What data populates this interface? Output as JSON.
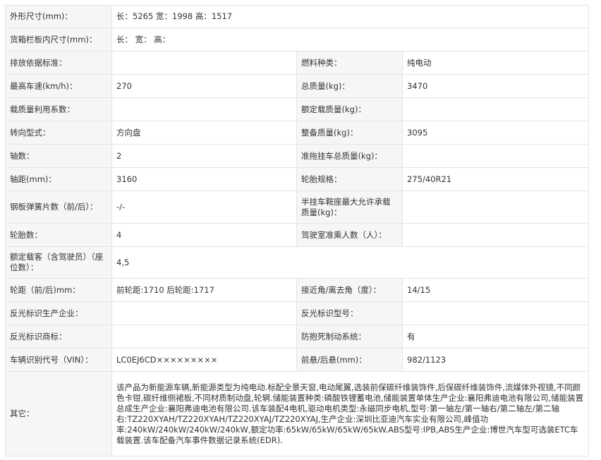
{
  "rows": [
    {
      "type": "wide",
      "label": "外形尺寸(mm)：",
      "value": "长：5265 宽：1998 高：1517"
    },
    {
      "type": "wide",
      "label": "货箱栏板内尺寸(mm)：",
      "value": "长：  宽：  高："
    },
    {
      "type": "pair",
      "label1": "排放依据标准：",
      "value1": "",
      "label2": "燃料种类：",
      "value2": "纯电动"
    },
    {
      "type": "pair",
      "label1": "最高车速(km/h)：",
      "value1": "270",
      "label2": "总质量(kg)：",
      "value2": "3470"
    },
    {
      "type": "pair",
      "label1": "载质量利用系数：",
      "value1": "",
      "label2": "额定载质量(kg)：",
      "value2": ""
    },
    {
      "type": "pair",
      "label1": "转向型式：",
      "value1": "方向盘",
      "label2": "整备质量(kg)：",
      "value2": "3095"
    },
    {
      "type": "pair",
      "label1": "轴数：",
      "value1": "2",
      "label2": "准拖挂车总质量(kg)：",
      "value2": ""
    },
    {
      "type": "pair",
      "label1": "轴距(mm)：",
      "value1": "3160",
      "label2": "轮胎规格：",
      "value2": "275/40R21"
    },
    {
      "type": "pair",
      "label1": "钢板弹簧片数（前/后）：",
      "value1": "-/-",
      "label2": "半挂车鞍座最大允许承载质量(kg)：",
      "value2": ""
    },
    {
      "type": "pair",
      "label1": "轮胎数：",
      "value1": "4",
      "label2": "驾驶室准乘人数（人）：",
      "value2": ""
    },
    {
      "type": "wide",
      "label": "额定载客（含驾驶员）（座位数）：",
      "value": "4,5"
    },
    {
      "type": "pair",
      "label1": "轮距（前/后)mm：",
      "value1": "前轮距:1710 后轮距:1717",
      "label2": "接近角/离去角（度）：",
      "value2": "14/15"
    },
    {
      "type": "pair",
      "label1": "反光标识生产企业：",
      "value1": "",
      "label2": "反光标识型号：",
      "value2": ""
    },
    {
      "type": "pair",
      "label1": "反光标识商标：",
      "value1": "",
      "label2": "防抱死制动系统：",
      "value2": "有"
    },
    {
      "type": "pair",
      "label1": "车辆识别代号（VIN）：",
      "value1": "LC0EJ6CD×××××××××",
      "label2": "前悬/后悬(mm)：",
      "value2": "982/1123"
    },
    {
      "type": "other",
      "label": "其它：",
      "value": "该产品为新能源车辆,新能源类型为纯电动.标配全景天窗,电动尾翼,选装前保碳纤维装饰件,后保碳纤维装饰件,流媒体外视镜,不同颜色卡钳,碳纤维侧裙板,不同材质制动盘,轮辋.储能装置种类:磷酸铁锂蓄电池,储能装置单体生产企业:襄阳弗迪电池有限公司,储能装置总成生产企业:襄阳弗迪电池有限公司.该车装配4电机,驱动电机类型:永磁同步电机,型号:第一轴左/第一轴右/第二轴左/第二轴右:TZ220XYAH/TZ220XYAH/TZ220XYAJ/TZ220XYAJ,生产企业:深圳比亚迪汽车实业有限公司,峰值功率:240kW/240kW/240kW/240kW,额定功率:65kW/65kW/65kW/65kW.ABS型号:IPB,ABS生产企业:博世汽车型可选装ETC车载装置.该车配备汽车事件数据记录系统(EDR)."
    }
  ]
}
